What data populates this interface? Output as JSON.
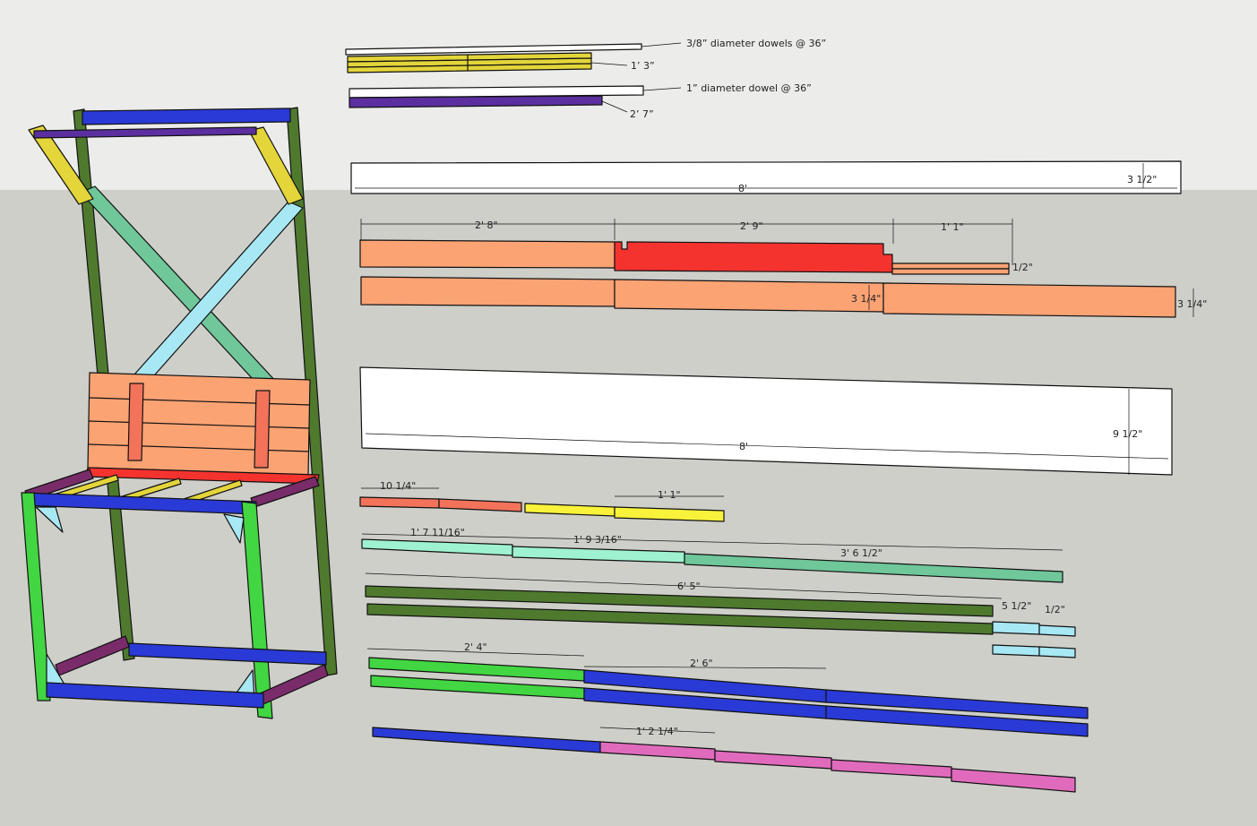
{
  "colors": {
    "sky": "#ececea",
    "ground": "#cfcfca",
    "white_board": "#ffffff",
    "orange_slat": "#fca374",
    "red_slat": "#f4332f",
    "yellow": "#e3d53a",
    "bright_yellow": "#f8f23a",
    "purple": "#5b2fa0",
    "blue": "#2a3ad6",
    "dark_green": "#4f7a2e",
    "light_green": "#42d642",
    "mint": "#9ff2cf",
    "sea_green": "#6fc79a",
    "cyan": "#a7e8f4",
    "pink": "#e06bbd",
    "salmon": "#f2735a",
    "plum": "#7a2c6a"
  },
  "dowels": {
    "small_note": "3/8” diameter dowels @ 36”",
    "small_cut": "1’ 3”",
    "large_note": "1” diameter dowel @ 36”",
    "large_cut": "2’ 7”"
  },
  "board_1x4": {
    "length": "8'",
    "width": "3 1/2\""
  },
  "slats": {
    "seg1": "2' 8\"",
    "seg2": "2' 9\"",
    "seg3": "1' 1\"",
    "thin_width": "1/2\"",
    "width_mid": "3 1/4\"",
    "width_end": "3 1/4\""
  },
  "board_1x10": {
    "length": "8'",
    "width": "9 1/2\""
  },
  "short_cuts": {
    "first": "10 1/4\"",
    "second": "1' 1\""
  },
  "diagonal_cuts": {
    "first": "1' 7 11/16\"",
    "second": "1' 9 3/16\"",
    "third": "3' 6 1/2\""
  },
  "legs": {
    "length": "6' 5\"",
    "block_a": "5 1/2\"",
    "block_b": "1/2\""
  },
  "frame_rails": {
    "front": "2' 4\"",
    "side": "2' 6\""
  },
  "bottom_rails": {
    "cut": "1' 2 1/4\""
  }
}
